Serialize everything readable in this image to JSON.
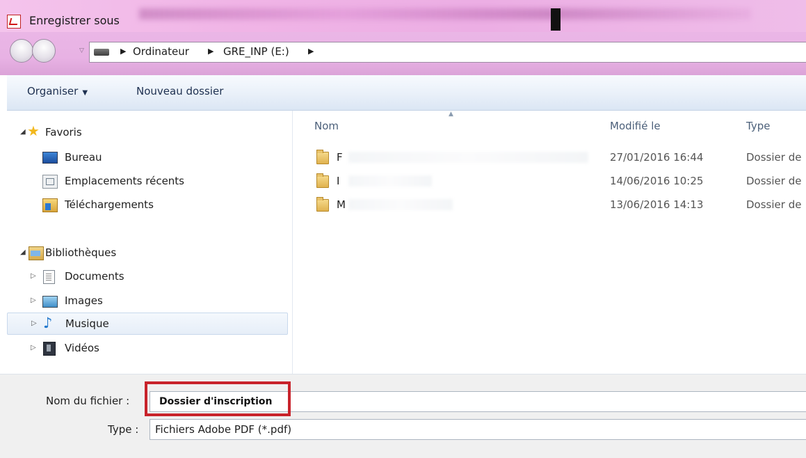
{
  "window": {
    "title": "Enregistrer sous"
  },
  "address": {
    "crumbs": [
      "Ordinateur",
      "GRE_INP (E:)"
    ]
  },
  "toolbar": {
    "organize_label": "Organiser",
    "new_folder_label": "Nouveau dossier"
  },
  "sidebar": {
    "favorites": {
      "label": "Favoris",
      "items": [
        {
          "label": "Bureau",
          "icon": "desktop-icon"
        },
        {
          "label": "Emplacements récents",
          "icon": "recent-places-icon"
        },
        {
          "label": "Téléchargements",
          "icon": "downloads-icon"
        }
      ]
    },
    "libraries": {
      "label": "Bibliothèques",
      "items": [
        {
          "label": "Documents",
          "icon": "documents-icon"
        },
        {
          "label": "Images",
          "icon": "images-icon"
        },
        {
          "label": "Musique",
          "icon": "music-icon",
          "selected": true
        },
        {
          "label": "Vidéos",
          "icon": "videos-icon"
        }
      ]
    }
  },
  "file_list": {
    "columns": [
      "Nom",
      "Modifié le",
      "Type"
    ],
    "rows": [
      {
        "name": "F",
        "modified": "27/01/2016 16:44",
        "type": "Dossier de"
      },
      {
        "name": "I",
        "modified": "14/06/2016 10:25",
        "type": "Dossier de"
      },
      {
        "name": "M",
        "modified": "13/06/2016 14:13",
        "type": "Dossier de"
      }
    ]
  },
  "form": {
    "filename_label": "Nom du fichier :",
    "filename_value": "Dossier d'inscription",
    "type_label": "Type :",
    "type_value": "Fichiers Adobe PDF (*.pdf)"
  },
  "colors": {
    "highlight": "#c8232b",
    "title_glass": "#eeb4e6",
    "toolbar": "#e9f0f9"
  }
}
